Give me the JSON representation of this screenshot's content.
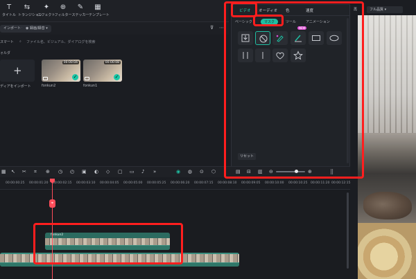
{
  "toolbar": {
    "items": [
      {
        "label": "タイトル",
        "icon": "T"
      },
      {
        "label": "トランジション",
        "icon": "⇆"
      },
      {
        "label": "エフェクト",
        "icon": "✦"
      },
      {
        "label": "フィルター",
        "icon": "⊕"
      },
      {
        "label": "ステッカー",
        "icon": "✎"
      },
      {
        "label": "テンプレート",
        "icon": "▦"
      }
    ]
  },
  "media": {
    "import_label": "インポート",
    "sort_label": "録画/録音",
    "smart_label": "スマート",
    "search_placeholder": "ファイル名、ビジュアル、ダイアログを検索",
    "folder_label": "ォルダ",
    "import_tile_label": "ディアをインポート",
    "clips": [
      {
        "name": "fonkun2",
        "duration": "00:00:04"
      },
      {
        "name": "fonkun1",
        "duration": "00:00:08"
      }
    ]
  },
  "panel": {
    "tabs": [
      "ビデオ",
      "オーディオ",
      "色",
      "速度"
    ],
    "subtabs": [
      "ベーシック",
      "マスク",
      "ツール",
      "アニメーション"
    ],
    "active_tab": "ビデオ",
    "active_subtab": "マスク",
    "new_badge": "NEW",
    "reset_label": "リセット"
  },
  "preview": {
    "quality_label": "フル品質",
    "mode_label": "再"
  },
  "timeline": {
    "ruler": [
      "00:00:00:25",
      "00:00:01:20",
      "00:00:02:15",
      "00:00:03:10",
      "00:00:04:05",
      "00:00:05:00",
      "00:00:05:25",
      "00:00:06:20",
      "00:00:07:15",
      "00:00:08:10",
      "00:00:09:05",
      "00:00:10:00",
      "00:00:10:25",
      "00:00:11:20",
      "00:00:12:15"
    ]
  },
  "colors": {
    "accent": "#1fbfa2",
    "highlight": "#ff1e1e",
    "playhead": "#ff4d5a"
  }
}
